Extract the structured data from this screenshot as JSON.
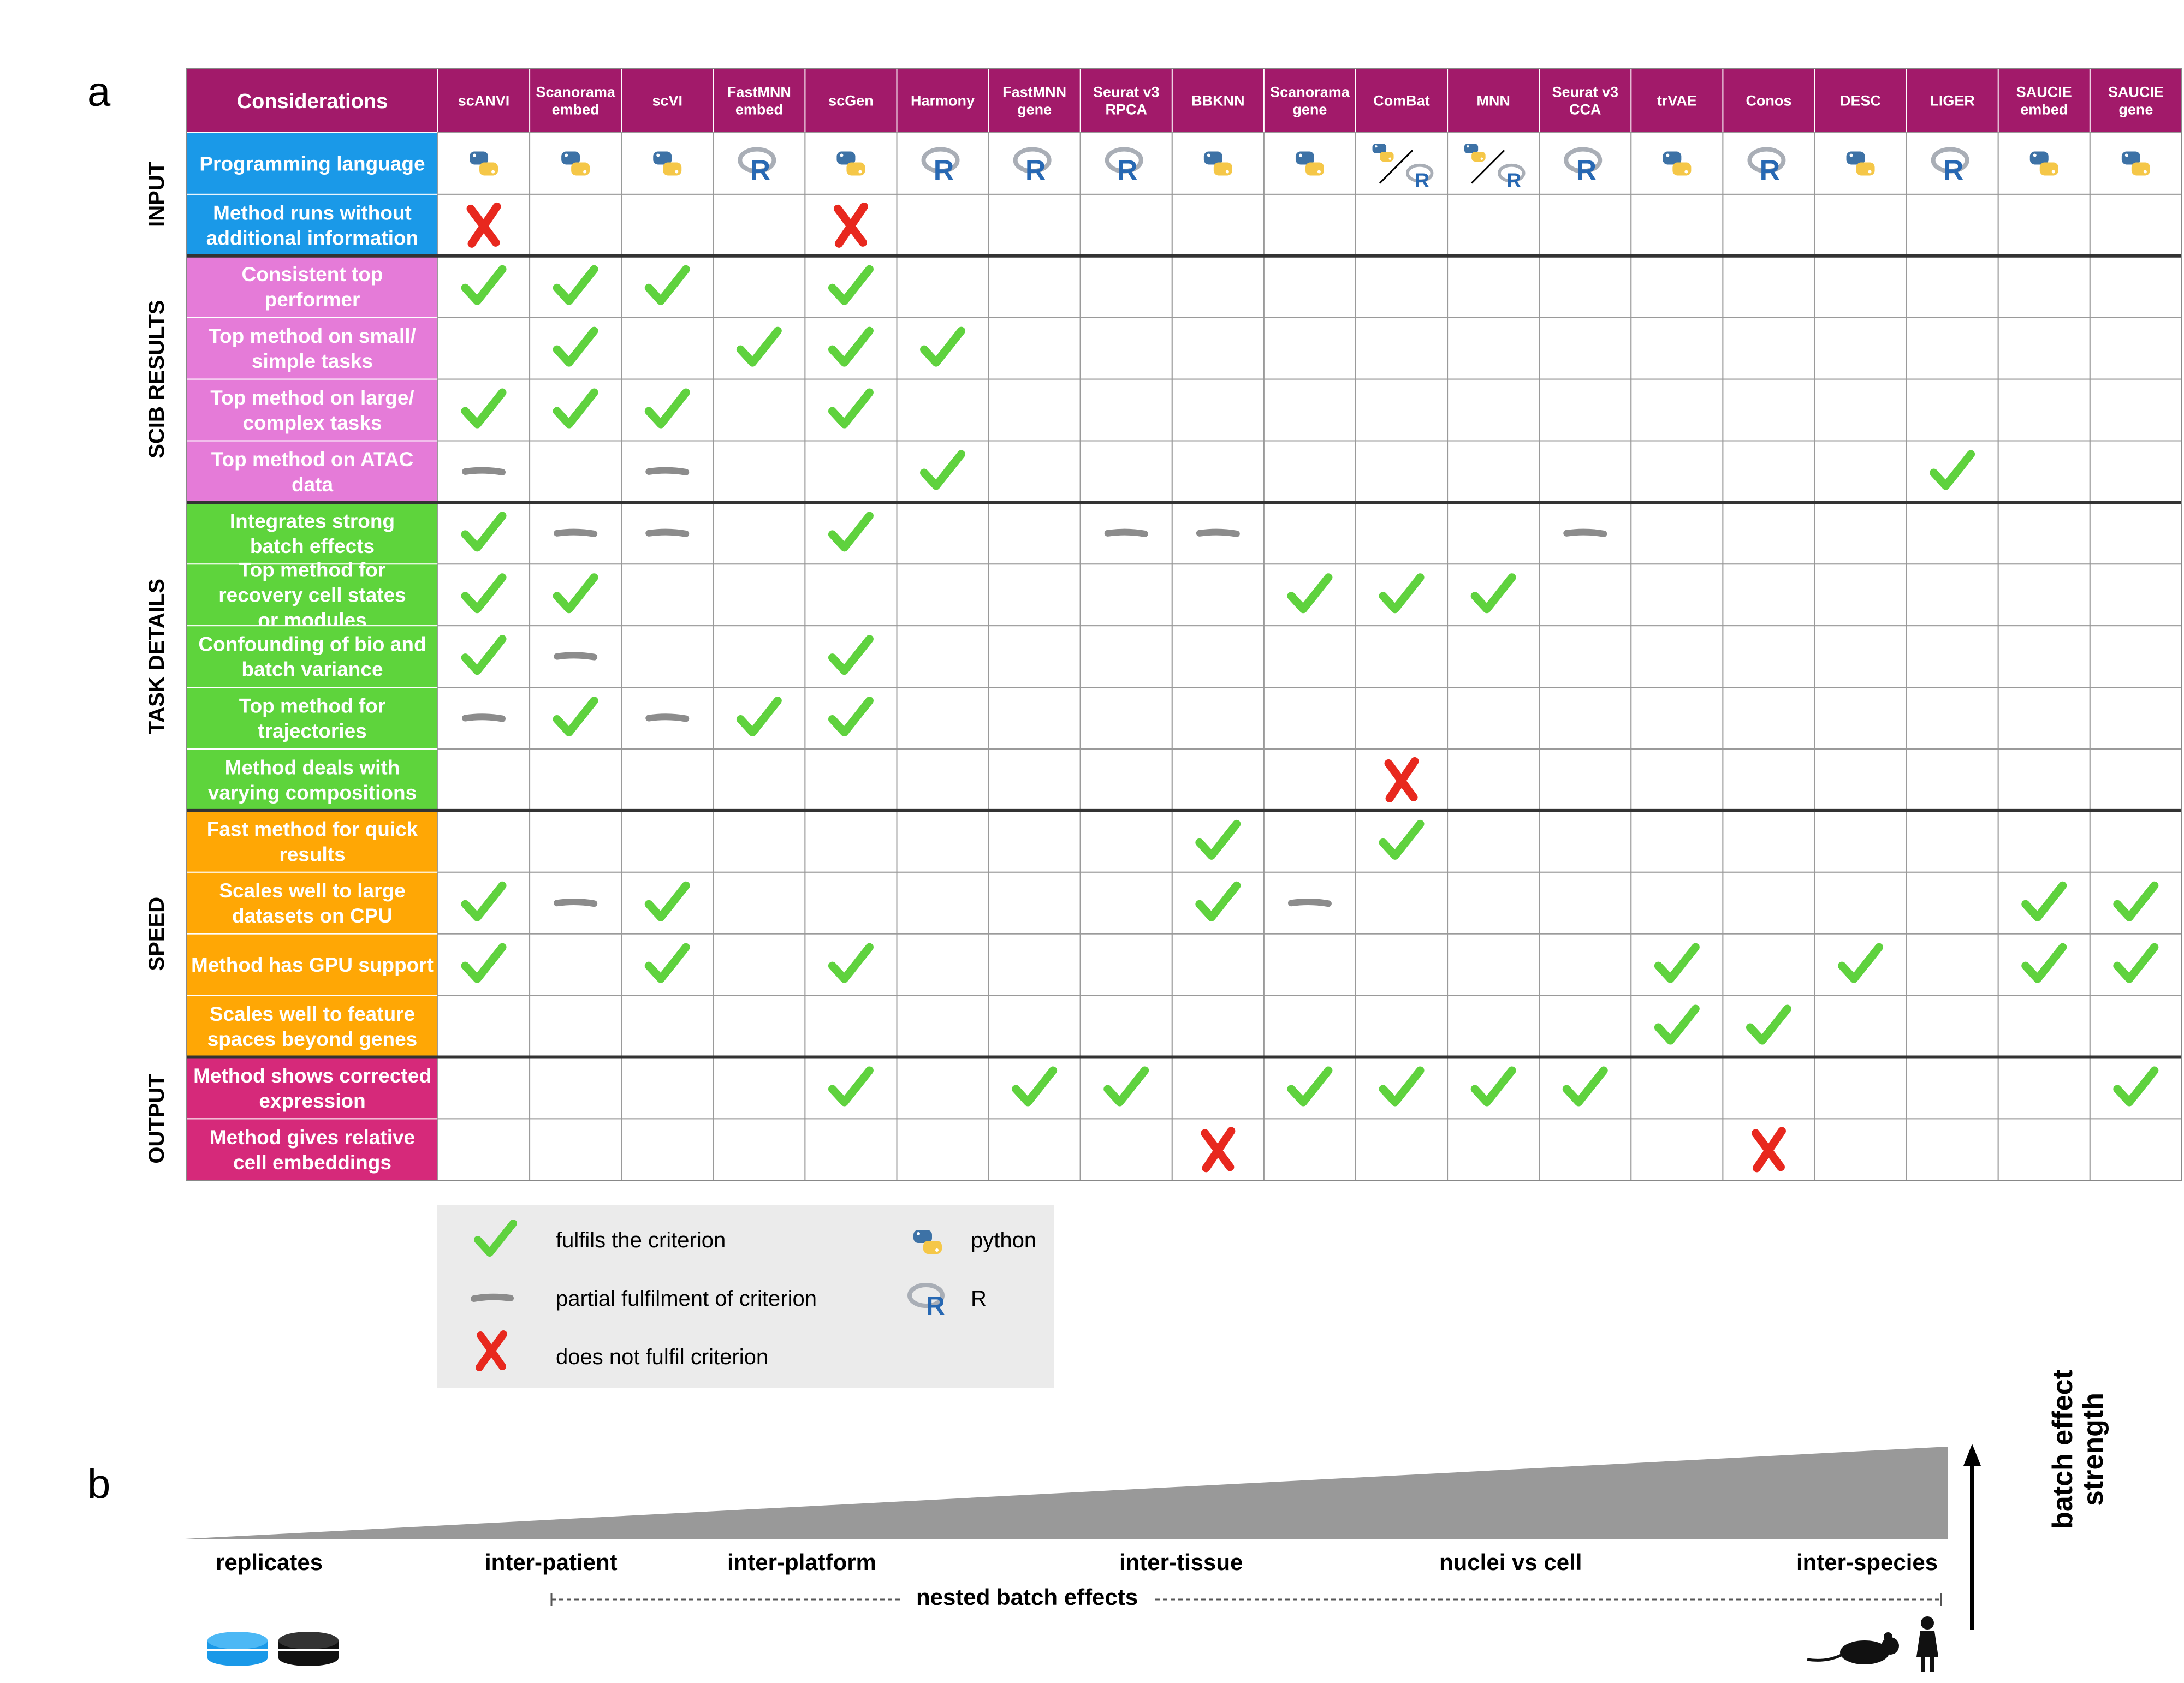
{
  "panel_a": {
    "letter": "a",
    "header_label": "Considerations",
    "methods": [
      "scANVI",
      "Scanorama embed",
      "scVI",
      "FastMNN embed",
      "scGen",
      "Harmony",
      "FastMNN gene",
      "Seurat v3 RPCA",
      "BBKNN",
      "Scanorama gene",
      "ComBat",
      "MNN",
      "Seurat v3 CCA",
      "trVAE",
      "Conos",
      "DESC",
      "LIGER",
      "SAUCIE embed",
      "SAUCIE gene"
    ],
    "language_row_label": "Programming language",
    "languages": [
      "python",
      "python",
      "python",
      "R",
      "python",
      "R",
      "R",
      "R",
      "python",
      "python",
      "python/R",
      "python/R",
      "R",
      "python",
      "R",
      "python",
      "R",
      "python",
      "python"
    ],
    "sections": [
      {
        "name": "INPUT",
        "color": "#1a99e8",
        "rows": [
          {
            "label": "Method runs without additional information",
            "marks": [
              "cross",
              "",
              "",
              "",
              "cross",
              "",
              "",
              "",
              "",
              "",
              "",
              "",
              "",
              "",
              "",
              "",
              "",
              "",
              ""
            ]
          }
        ]
      },
      {
        "name": "SCIB RESULTS",
        "color": "#e57bd8",
        "rows": [
          {
            "label": "Consistent top performer",
            "marks": [
              "check",
              "check",
              "check",
              "",
              "check",
              "",
              "",
              "",
              "",
              "",
              "",
              "",
              "",
              "",
              "",
              "",
              "",
              "",
              ""
            ]
          },
          {
            "label": "Top method on small/ simple tasks",
            "marks": [
              "",
              "check",
              "",
              "check",
              "check",
              "check",
              "",
              "",
              "",
              "",
              "",
              "",
              "",
              "",
              "",
              "",
              "",
              "",
              ""
            ]
          },
          {
            "label": "Top method on large/ complex tasks",
            "marks": [
              "check",
              "check",
              "check",
              "",
              "check",
              "",
              "",
              "",
              "",
              "",
              "",
              "",
              "",
              "",
              "",
              "",
              "",
              "",
              ""
            ]
          },
          {
            "label": "Top method on ATAC data",
            "marks": [
              "dash",
              "",
              "dash",
              "",
              "",
              "check",
              "",
              "",
              "",
              "",
              "",
              "",
              "",
              "",
              "",
              "",
              "check",
              "",
              ""
            ]
          }
        ]
      },
      {
        "name": "TASK DETAILS",
        "color": "#5ed43c",
        "rows": [
          {
            "label": "Integrates strong batch effects",
            "marks": [
              "check",
              "dash",
              "dash",
              "",
              "check",
              "",
              "",
              "dash",
              "dash",
              "",
              "",
              "",
              "dash",
              "",
              "",
              "",
              "",
              "",
              ""
            ]
          },
          {
            "label": "Top method for recovery cell states or modules",
            "marks": [
              "check",
              "check",
              "",
              "",
              "",
              "",
              "",
              "",
              "",
              "check",
              "check",
              "check",
              "",
              "",
              "",
              "",
              "",
              "",
              ""
            ]
          },
          {
            "label": "Confounding of bio and batch variance",
            "marks": [
              "check",
              "dash",
              "",
              "",
              "check",
              "",
              "",
              "",
              "",
              "",
              "",
              "",
              "",
              "",
              "",
              "",
              "",
              "",
              ""
            ]
          },
          {
            "label": "Top method for trajectories",
            "marks": [
              "dash",
              "check",
              "dash",
              "check",
              "check",
              "",
              "",
              "",
              "",
              "",
              "",
              "",
              "",
              "",
              "",
              "",
              "",
              "",
              ""
            ]
          },
          {
            "label": "Method deals with varying compositions",
            "marks": [
              "",
              "",
              "",
              "",
              "",
              "",
              "",
              "",
              "",
              "",
              "cross",
              "",
              "",
              "",
              "",
              "",
              "",
              "",
              ""
            ]
          }
        ]
      },
      {
        "name": "SPEED",
        "color": "#ffa705",
        "rows": [
          {
            "label": "Fast method for quick results",
            "marks": [
              "",
              "",
              "",
              "",
              "",
              "",
              "",
              "",
              "check",
              "",
              "check",
              "",
              "",
              "",
              "",
              "",
              "",
              "",
              ""
            ]
          },
          {
            "label": "Scales well to large datasets on CPU",
            "marks": [
              "check",
              "dash",
              "check",
              "",
              "",
              "",
              "",
              "",
              "check",
              "dash",
              "",
              "",
              "",
              "",
              "",
              "",
              "",
              "check",
              "check"
            ]
          },
          {
            "label": "Method has GPU support",
            "marks": [
              "check",
              "",
              "check",
              "",
              "check",
              "",
              "",
              "",
              "",
              "",
              "",
              "",
              "",
              "check",
              "",
              "check",
              "",
              "check",
              "check"
            ]
          },
          {
            "label": "Scales well to feature spaces beyond genes",
            "marks": [
              "",
              "",
              "",
              "",
              "",
              "",
              "",
              "",
              "",
              "",
              "",
              "",
              "",
              "check",
              "check",
              "",
              "",
              "",
              ""
            ]
          }
        ]
      },
      {
        "name": "OUTPUT",
        "color": "#d6297a",
        "rows": [
          {
            "label": "Method shows corrected expression",
            "marks": [
              "",
              "",
              "",
              "",
              "check",
              "",
              "check",
              "check",
              "",
              "check",
              "check",
              "check",
              "check",
              "",
              "",
              "",
              "",
              "",
              "check"
            ]
          },
          {
            "label": "Method gives relative cell embeddings",
            "marks": [
              "",
              "",
              "",
              "",
              "",
              "",
              "",
              "",
              "cross",
              "",
              "",
              "",
              "",
              "",
              "cross",
              "",
              "",
              "",
              ""
            ]
          }
        ]
      }
    ],
    "header_color": "#a21a6a",
    "check_color": "#5fd23e",
    "cross_color": "#e8281e",
    "dash_color": "#8c8c8c"
  },
  "legend": {
    "fulfils": "fulfils the criterion",
    "partial": "partial fulfilment of criterion",
    "not": "does not fulfil criterion",
    "python": "python",
    "r": "R"
  },
  "panel_b": {
    "letter": "b",
    "labels": [
      "replicates",
      "inter-patient",
      "inter-platform",
      "inter-tissue",
      "nuclei vs cell",
      "inter-species"
    ],
    "nested": "nested batch effects",
    "strength": "batch effect strength",
    "wedge_color": "#999999"
  }
}
